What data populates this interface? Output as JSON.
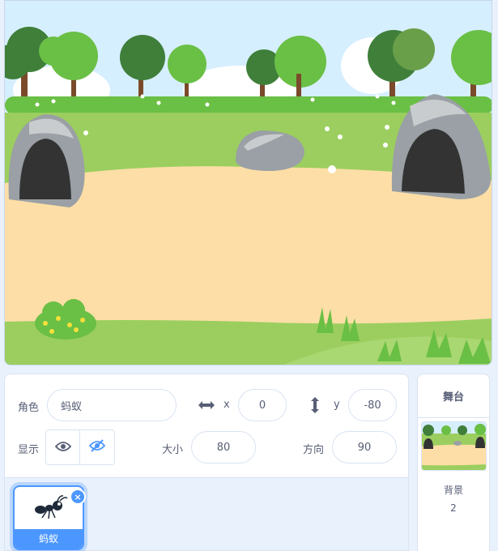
{
  "sprite_info": {
    "sprite_label": "角色",
    "sprite_name": "蚂蚁",
    "x_label": "x",
    "x_value": "0",
    "y_label": "y",
    "y_value": "-80",
    "show_label": "显示",
    "size_label": "大小",
    "size_value": "80",
    "direction_label": "方向",
    "direction_value": "90"
  },
  "sprite_list": {
    "items": [
      {
        "name": "蚂蚁",
        "icon": "ant-icon"
      }
    ],
    "delete_glyph": "×"
  },
  "stage_panel": {
    "header": "舞台",
    "backdrops_label": "背景",
    "backdrops_count": "2"
  },
  "colors": {
    "accent": "#4c97ff",
    "text": "#575e75",
    "panel_bg": "#e9f1fc",
    "border": "#d9e3f2"
  }
}
